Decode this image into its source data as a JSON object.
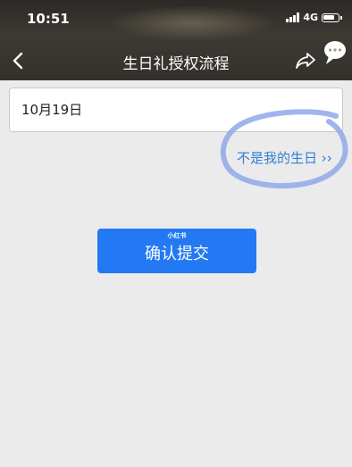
{
  "status_bar": {
    "time": "10:51",
    "network": "4G"
  },
  "nav": {
    "title": "生日礼授权流程"
  },
  "form": {
    "birthday_value": "10月19日"
  },
  "link": {
    "not_my_birthday": "不是我的生日 ››"
  },
  "submit": {
    "label": "确认提交",
    "watermark": "小红书"
  },
  "icons": {
    "back": "chevron-left-icon",
    "share": "share-icon",
    "chat": "chat-bubble-icon",
    "signal": "signal-icon",
    "battery": "battery-icon"
  },
  "colors": {
    "accent_blue": "#2279f3",
    "link_blue": "#2f7fd7",
    "annotation_blue": "#8fa8ea"
  }
}
